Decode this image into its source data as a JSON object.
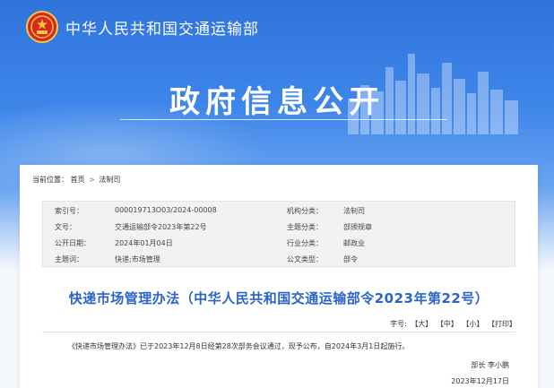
{
  "header": {
    "ministry_name": "中华人民共和国交通运输部",
    "section_title": "政府信息公开"
  },
  "breadcrumb": {
    "label": "当前位置：",
    "items": [
      "首页",
      "法制司"
    ],
    "separator": ">"
  },
  "info": {
    "rows": [
      {
        "label1": "索引号：",
        "value1": "000019713O03/2024-00008",
        "label2": "机构分类：",
        "value2": "法制司"
      },
      {
        "label1": "文号：",
        "value1": "交通运输部令2023年第22号",
        "label2": "主题分类：",
        "value2": "部颁规章"
      },
      {
        "label1": "公开日期：",
        "value1": "2024年01月04日",
        "label2": "行业分类：",
        "value2": "邮政业"
      },
      {
        "label1": "主题词：",
        "value1": "快递;市场管理",
        "label2": "公文类型：",
        "value2": "部令"
      }
    ]
  },
  "document": {
    "title": "快递市场管理办法（中华人民共和国交通运输部令2023年第22号）",
    "font_size_label": "字号:",
    "font_large": "【大】",
    "font_medium": "【中】",
    "font_small": "【小】",
    "print": "【打印】",
    "body": "《快递市场管理办法》已于2023年12月8日经第28次部务会议通过，现予公布，自2024年3月1日起施行。",
    "signer": "部长 李小鹏",
    "sign_date": "2023年12月17日"
  },
  "colors": {
    "banner_blue": "#2f74dc",
    "title_blue": "#2a64c9",
    "emblem_red": "#d8281e",
    "emblem_gold": "#f5c542"
  }
}
